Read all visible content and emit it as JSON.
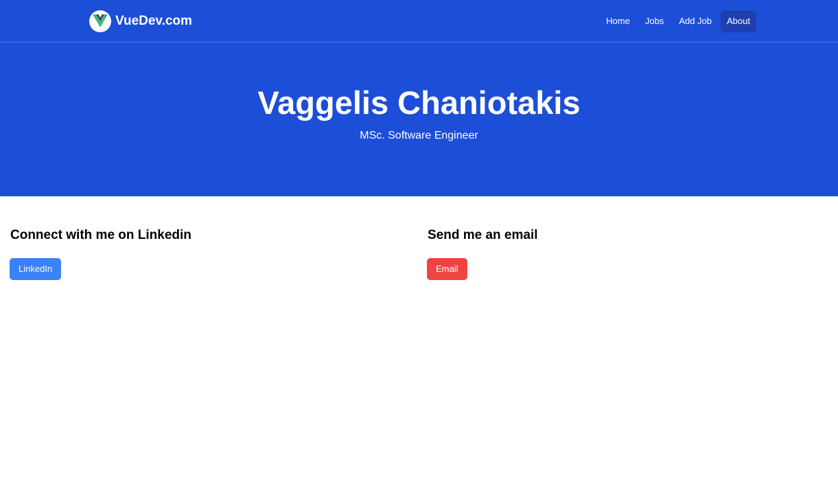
{
  "navbar": {
    "brand": "VueDev.com",
    "logo_icon": "vue-logo-icon",
    "links": [
      {
        "label": "Home",
        "active": false
      },
      {
        "label": "Jobs",
        "active": false
      },
      {
        "label": "Add Job",
        "active": false
      },
      {
        "label": "About",
        "active": true
      }
    ]
  },
  "hero": {
    "title": "Vaggelis Chaniotakis",
    "subtitle": "MSc. Software Engineer"
  },
  "linkedin_section": {
    "heading": "Connect with me on Linkedin",
    "button_label": "LinkedIn"
  },
  "email_section": {
    "heading": "Send me an email",
    "button_label": "Email"
  },
  "colors": {
    "primary": "#1d4ed8",
    "nav_active": "#1e40af",
    "linkedin_button": "#3b82f6",
    "email_button": "#ef4444",
    "vue_green": "#41b883",
    "vue_dark": "#34495e"
  }
}
